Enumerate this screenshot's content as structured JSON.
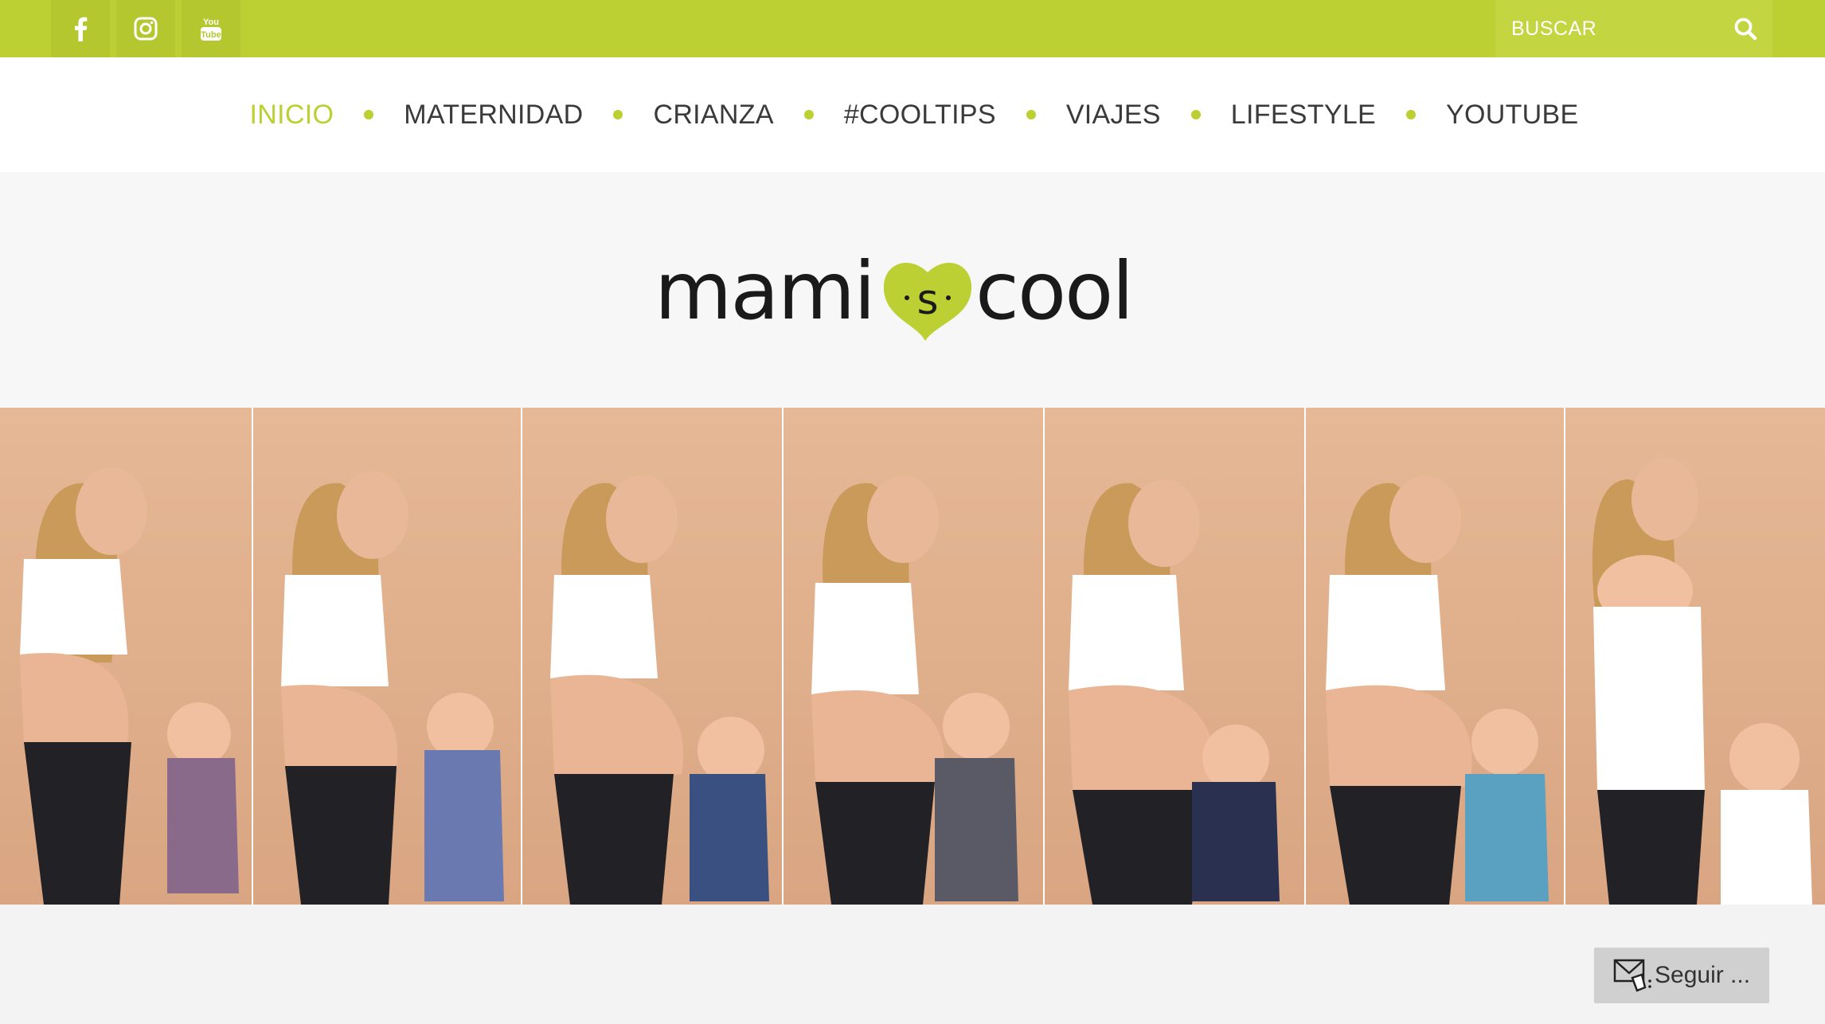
{
  "topbar": {
    "social": [
      {
        "icon": "facebook-icon"
      },
      {
        "icon": "instagram-icon"
      },
      {
        "icon": "youtube-icon"
      }
    ],
    "search": {
      "placeholder": "BUSCAR",
      "icon": "search-icon"
    }
  },
  "nav": {
    "items": [
      {
        "label": "INICIO",
        "active": true
      },
      {
        "label": "MATERNIDAD"
      },
      {
        "label": "CRIANZA"
      },
      {
        "label": "#COOLTIPS"
      },
      {
        "label": "VIAJES"
      },
      {
        "label": "LIFESTYLE"
      },
      {
        "label": "YOUTUBE"
      }
    ]
  },
  "logo": {
    "text": "mamiscool"
  },
  "banner": {
    "panels": 7
  },
  "follow": {
    "label": "Seguir ...",
    "icon": "follow-mail-icon"
  },
  "colors": {
    "accent": "#bccf33",
    "text": "#3a3a3a",
    "header_bg": "#f7f7f7"
  }
}
